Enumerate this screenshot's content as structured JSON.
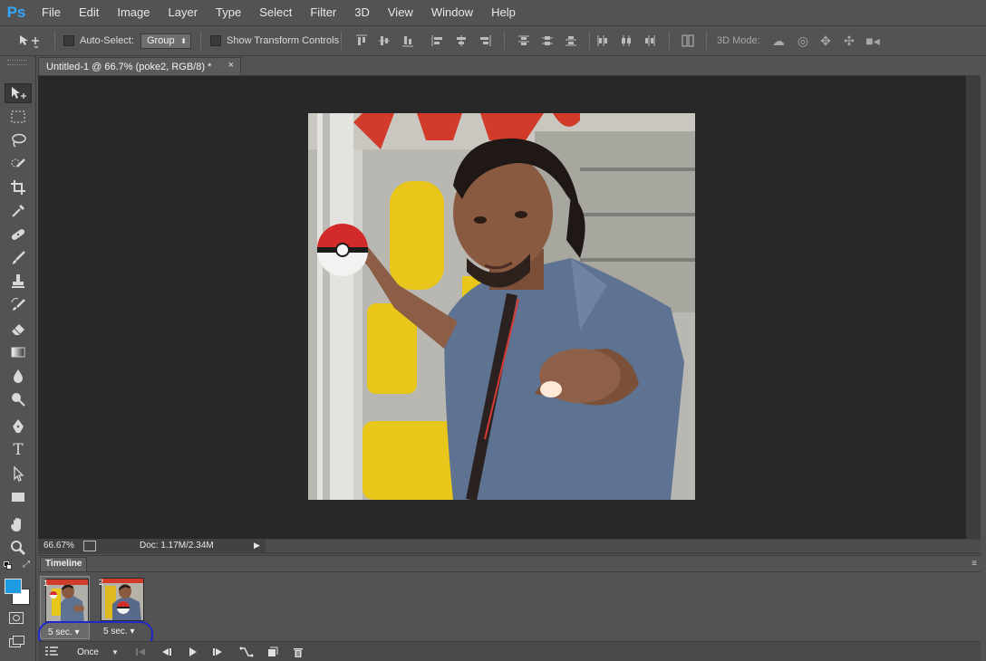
{
  "app": {
    "logo": "Ps",
    "accent_color": "#31a8ff"
  },
  "menu": [
    "File",
    "Edit",
    "Image",
    "Layer",
    "Type",
    "Select",
    "Filter",
    "3D",
    "View",
    "Window",
    "Help"
  ],
  "options_bar": {
    "auto_select_label": "Auto-Select:",
    "auto_select_checked": false,
    "auto_select_target": "Group",
    "show_transform_label": "Show Transform Controls",
    "show_transform_checked": false,
    "mode_3d_label": "3D Mode:"
  },
  "document": {
    "tab_title": "Untitled-1 @ 66.7% (poke2, RGB/8) *",
    "close_glyph": "×"
  },
  "status": {
    "zoom": "66.67%",
    "doc_info": "Doc: 1.17M/2.34M",
    "arrow_glyph": "▶"
  },
  "colors": {
    "foreground": "#1e9ae0",
    "background": "#ffffff",
    "highlight_ring": "#2028c8"
  },
  "timeline": {
    "title": "Timeline",
    "frames": [
      {
        "number": "1",
        "delay": "5 sec.",
        "selected": true
      },
      {
        "number": "2",
        "delay": "5 sec.",
        "selected": false
      }
    ],
    "loop": "Once",
    "dropdown_glyph": "▾"
  },
  "tools": [
    {
      "name": "move-tool-icon",
      "active": true
    },
    {
      "name": "marquee-tool-icon"
    },
    {
      "name": "lasso-tool-icon"
    },
    {
      "name": "quick-select-tool-icon"
    },
    {
      "name": "crop-tool-icon"
    },
    {
      "name": "eyedropper-tool-icon"
    },
    {
      "name": "healing-brush-tool-icon"
    },
    {
      "name": "brush-tool-icon"
    },
    {
      "name": "clone-stamp-tool-icon"
    },
    {
      "name": "history-brush-tool-icon"
    },
    {
      "name": "eraser-tool-icon"
    },
    {
      "name": "gradient-tool-icon"
    },
    {
      "name": "blur-tool-icon"
    },
    {
      "name": "dodge-tool-icon"
    },
    {
      "name": "pen-tool-icon"
    },
    {
      "name": "type-tool-icon"
    },
    {
      "name": "path-selection-tool-icon"
    },
    {
      "name": "rectangle-tool-icon"
    },
    {
      "name": "hand-tool-icon"
    },
    {
      "name": "zoom-tool-icon"
    }
  ],
  "type_tool_glyph": "T"
}
